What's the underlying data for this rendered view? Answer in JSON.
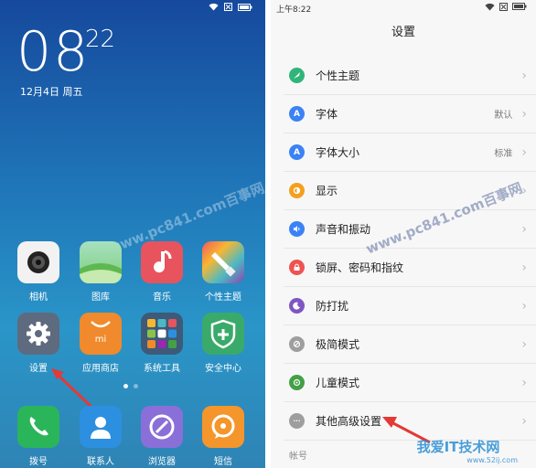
{
  "home": {
    "clock_hours": "08",
    "clock_minutes": "22",
    "date": "12月4日 周五",
    "watermark": "www.pc841.com百事网",
    "apps_row1": [
      {
        "label": "相机",
        "icon": "camera-icon",
        "color": "#f3f3f3"
      },
      {
        "label": "图库",
        "icon": "gallery-icon",
        "color": "#9fd7a0"
      },
      {
        "label": "音乐",
        "icon": "music-icon",
        "color": "#e8545d"
      },
      {
        "label": "个性主题",
        "icon": "theme-brush-icon",
        "color": "#f2a438"
      }
    ],
    "apps_row2": [
      {
        "label": "设置",
        "icon": "gear-icon",
        "color": "#5e6a7e"
      },
      {
        "label": "应用商店",
        "icon": "mi-store-icon",
        "color": "#f08a2c"
      },
      {
        "label": "系统工具",
        "icon": "folder-grid-icon",
        "color": "#3d5a78"
      },
      {
        "label": "安全中心",
        "icon": "shield-plus-icon",
        "color": "#3aaa6a"
      }
    ],
    "dock": [
      {
        "label": "拨号",
        "icon": "phone-icon",
        "color": "#2bb55a"
      },
      {
        "label": "联系人",
        "icon": "contact-icon",
        "color": "#2d8fe0"
      },
      {
        "label": "浏览器",
        "icon": "browser-icon",
        "color": "#8b6fd8"
      },
      {
        "label": "短信",
        "icon": "message-icon",
        "color": "#f4962b"
      }
    ]
  },
  "settings": {
    "status_time": "上午8:22",
    "title": "设置",
    "watermark": "www.pc841.com百事网",
    "items": [
      {
        "label": "个性主题",
        "value": "",
        "icon": "theme-icon",
        "color": "#2fb57a"
      },
      {
        "label": "字体",
        "value": "默认",
        "icon": "font-icon",
        "color": "#3b82f6",
        "glyph": "A"
      },
      {
        "label": "字体大小",
        "value": "标准",
        "icon": "font-size-icon",
        "color": "#3b82f6",
        "glyph": "A"
      },
      {
        "label": "显示",
        "value": "",
        "icon": "display-icon",
        "color": "#f3a020"
      },
      {
        "label": "声音和振动",
        "value": "",
        "icon": "sound-icon",
        "color": "#3b82f6"
      },
      {
        "label": "锁屏、密码和指纹",
        "value": "",
        "icon": "lock-icon",
        "color": "#ef5350"
      },
      {
        "label": "防打扰",
        "value": "",
        "icon": "moon-icon",
        "color": "#7e57c2"
      },
      {
        "label": "极简模式",
        "value": "",
        "icon": "simple-mode-icon",
        "color": "#9e9e9e"
      },
      {
        "label": "儿童模式",
        "value": "",
        "icon": "child-mode-icon",
        "color": "#43a047"
      },
      {
        "label": "其他高级设置",
        "value": "",
        "icon": "more-icon",
        "color": "#9e9e9e",
        "glyph": "···"
      }
    ],
    "section_label": "帐号"
  },
  "footer_watermark": "我爱IT技术网",
  "footer_url": "www.52ij.com"
}
